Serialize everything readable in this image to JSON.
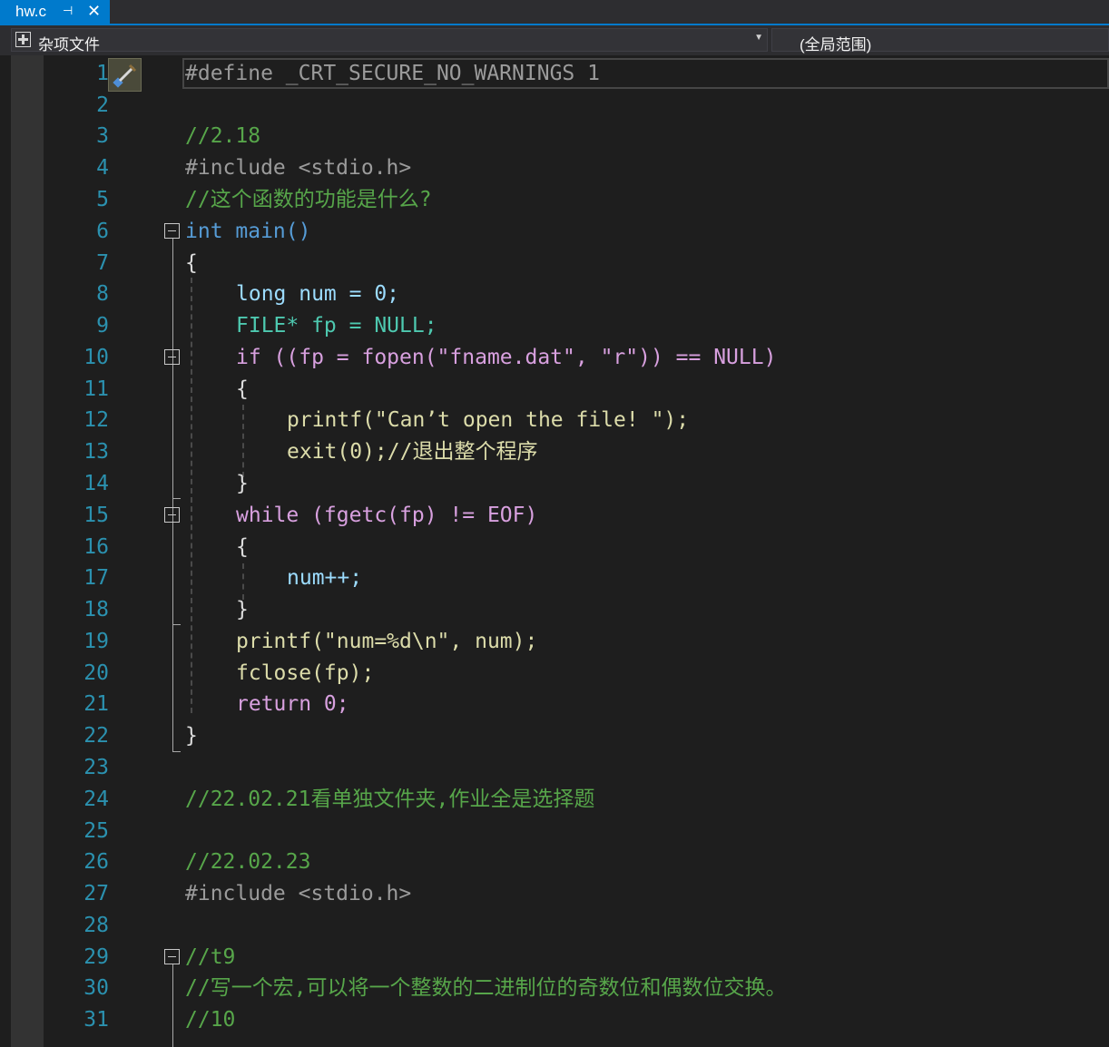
{
  "tab": {
    "filename": "hw.c",
    "pin_icon": "pin-icon",
    "close_icon": "close-icon"
  },
  "navbar": {
    "project": "杂项文件",
    "scope": "(全局范围)"
  },
  "lines": [
    {
      "n": "1",
      "text": "#define _CRT_SECURE_NO_WARNINGS 1"
    },
    {
      "n": "2",
      "text": ""
    },
    {
      "n": "3",
      "text": "//2.18"
    },
    {
      "n": "4",
      "text": "#include <stdio.h>"
    },
    {
      "n": "5",
      "text": "//这个函数的功能是什么?"
    },
    {
      "n": "6",
      "text": "int main()"
    },
    {
      "n": "7",
      "text": "{"
    },
    {
      "n": "8",
      "text": "long num = 0;"
    },
    {
      "n": "9",
      "text": "FILE* fp = NULL;"
    },
    {
      "n": "10",
      "text": "if ((fp = fopen(\"fname.dat\", \"r\")) == NULL)"
    },
    {
      "n": "11",
      "text": "{"
    },
    {
      "n": "12",
      "text": "printf(\"Can’t open the file! \");"
    },
    {
      "n": "13",
      "text": "exit(0);//退出整个程序"
    },
    {
      "n": "14",
      "text": "}"
    },
    {
      "n": "15",
      "text": "while (fgetc(fp) != EOF)"
    },
    {
      "n": "16",
      "text": "{"
    },
    {
      "n": "17",
      "text": "num++;"
    },
    {
      "n": "18",
      "text": "}"
    },
    {
      "n": "19",
      "text": "printf(\"num=%d\\n\", num);"
    },
    {
      "n": "20",
      "text": "fclose(fp);"
    },
    {
      "n": "21",
      "text": "return 0;"
    },
    {
      "n": "22",
      "text": "}"
    },
    {
      "n": "23",
      "text": ""
    },
    {
      "n": "24",
      "text": "//22.02.21看单独文件夹,作业全是选择题"
    },
    {
      "n": "25",
      "text": ""
    },
    {
      "n": "26",
      "text": "//22.02.23"
    },
    {
      "n": "27",
      "text": "#include <stdio.h>"
    },
    {
      "n": "28",
      "text": ""
    },
    {
      "n": "29",
      "text": "//t9"
    },
    {
      "n": "30",
      "text": "//写一个宏,可以将一个整数的二进制位的奇数位和偶数位交换。"
    },
    {
      "n": "31",
      "text": "//10"
    }
  ],
  "quick_action_icon": "screwdriver-brush-icon",
  "colors": {
    "accent": "#007acc",
    "background": "#1e1e1e",
    "line_number": "#2b91af",
    "comment": "#57a64a",
    "keyword": "#569cd6"
  }
}
